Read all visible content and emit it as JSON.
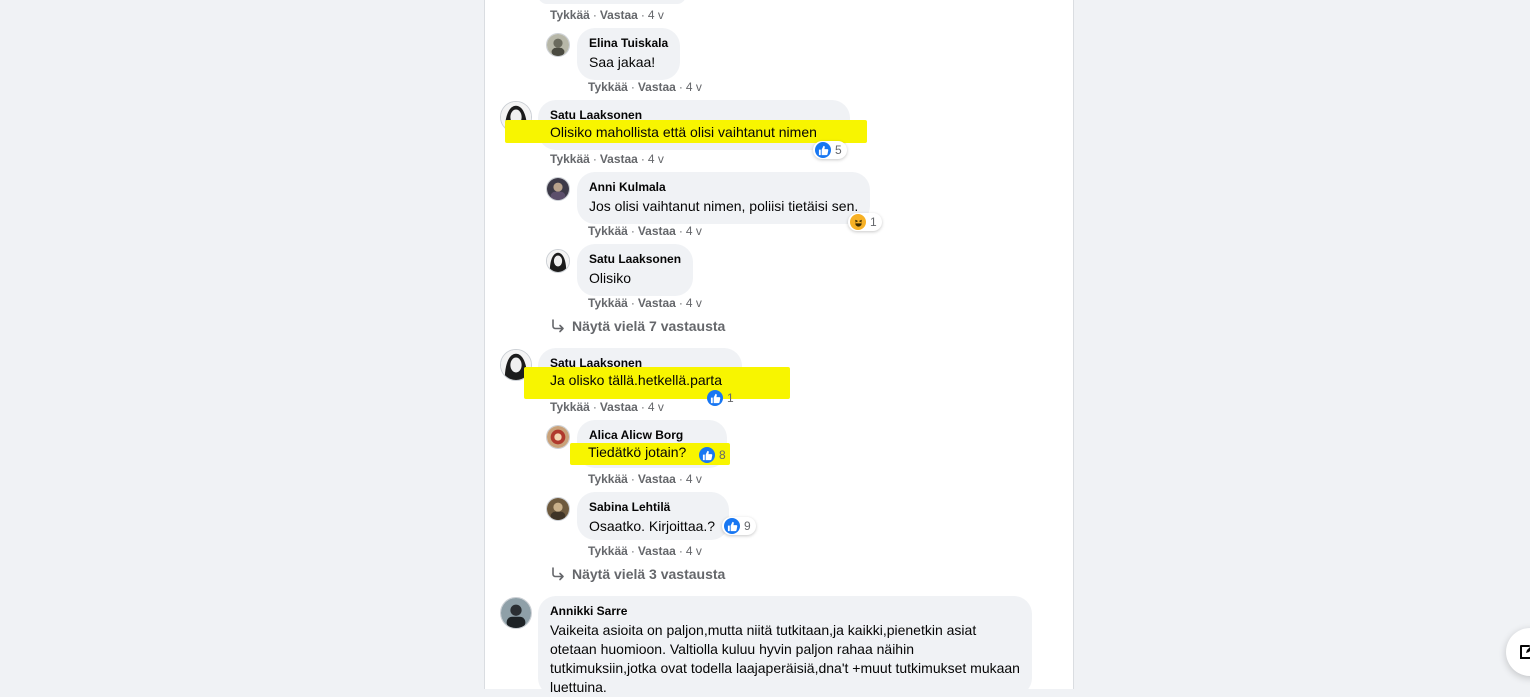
{
  "actions": {
    "like": "Tykkää",
    "reply": "Vastaa",
    "time": "4 v"
  },
  "comments": [
    {
      "author": "Elina Tuiskala",
      "text": "Saa jakaa!",
      "time": "4 v"
    },
    {
      "author": "Satu Laaksonen",
      "text": "Olisiko mahollista että olisi vaihtanut nimen",
      "time": "4 v",
      "reaction": {
        "icon": "like-icon",
        "count": "5"
      }
    },
    {
      "author": "Anni Kulmala",
      "text": "Jos olisi vaihtanut nimen, poliisi tietäisi sen.",
      "time": "4 v",
      "reaction": {
        "icon": "haha-icon",
        "count": "1"
      }
    },
    {
      "author": "Satu Laaksonen",
      "text": "Olisiko",
      "time": "4 v"
    },
    {
      "author": "Satu Laaksonen",
      "text": "Ja olisko tällä.hetkellä.parta",
      "time": "4 v",
      "reaction": {
        "icon": "like-icon",
        "count": "1"
      }
    },
    {
      "author": "Alica Alicw Borg",
      "text": "Tiedätkö jotain?",
      "time": "4 v",
      "reaction": {
        "icon": "like-icon",
        "count": "8"
      }
    },
    {
      "author": "Sabina Lehtilä",
      "text": "Osaatko. Kirjoittaa.?",
      "time": "4 v",
      "reaction": {
        "icon": "like-icon",
        "count": "9"
      }
    },
    {
      "author": "Annikki Sarre",
      "text": "Vaikeita asioita on paljon,mutta niitä tutkitaan,ja kaikki,pienetkin asiat otetaan huomioon. Valtiolla kuluu hyvin paljon rahaa näihin tutkimuksiin,jotka ovat todella laajaperäisiä,dna't +muut tutkimukset mukaan luettuina."
    }
  ],
  "more_replies": [
    "Näytä vielä 7 vastausta",
    "Näytä vielä 3 vastausta"
  ],
  "colors": {
    "page_bg": "#f0f2f5",
    "bubble_bg": "#f0f2f5",
    "highlight": "#f8f500",
    "like_blue": "#1877f2",
    "muted_text": "#65676b"
  }
}
